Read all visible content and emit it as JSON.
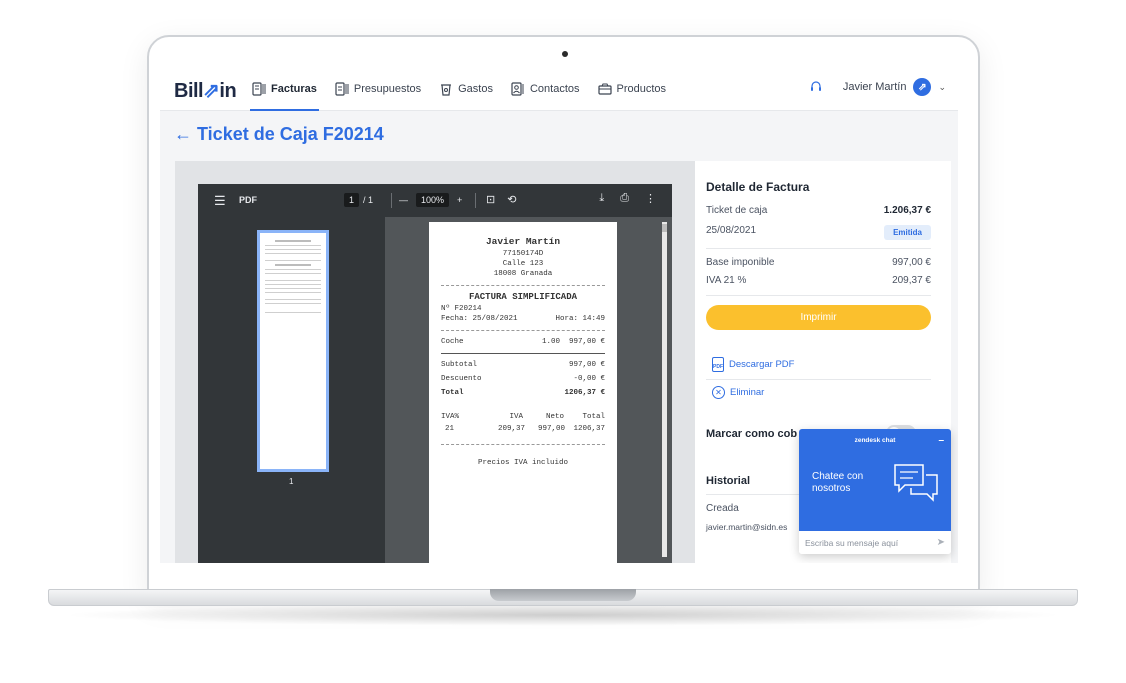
{
  "app": {
    "logo_text": "Bill",
    "logo_suffix": "in",
    "nav": [
      {
        "label": "Facturas",
        "icon": "invoice-icon",
        "active": true
      },
      {
        "label": "Presupuestos",
        "icon": "budget-icon",
        "active": false
      },
      {
        "label": "Gastos",
        "icon": "expense-icon",
        "active": false
      },
      {
        "label": "Contactos",
        "icon": "contacts-icon",
        "active": false
      },
      {
        "label": "Productos",
        "icon": "products-icon",
        "active": false
      }
    ],
    "user_name": "Javier Martín",
    "accent_color": "#2f6de1"
  },
  "page": {
    "title": "Ticket de Caja F20214"
  },
  "pdf_viewer": {
    "title": "PDF",
    "page_current": "1",
    "page_total": "/ 1",
    "zoom": "100%",
    "thumbnail_page": "1"
  },
  "receipt": {
    "name": "Javier Martín",
    "tax_id": "77150174D",
    "address": "Calle 123",
    "city": "18008 Granada",
    "doc_title": "FACTURA SIMPLIFICADA",
    "number": "Nº F20214",
    "date": "Fecha: 25/08/2021",
    "time": "Hora: 14:49",
    "item_name": "Coche",
    "item_qty": "1.00",
    "item_amount": "997,00 €",
    "subtotal_label": "Subtotal",
    "subtotal_value": "997,00 €",
    "discount_label": "Descuento",
    "discount_value": "-0,00 €",
    "total_label": "Total",
    "total_value": "1206,37 €",
    "tax_headers": [
      "IVA%",
      "IVA",
      "Neto",
      "Total"
    ],
    "tax_row": [
      "21",
      "209,37",
      "997,00",
      "1206,37"
    ],
    "footer": "Precios IVA incluido"
  },
  "detail": {
    "heading": "Detalle de Factura",
    "type_label": "Ticket de caja",
    "type_amount": "1.206,37 €",
    "date": "25/08/2021",
    "status": "Emitida",
    "base_label": "Base imponible",
    "base_value": "997,00 €",
    "iva_label": "IVA 21 %",
    "iva_value": "209,37 €",
    "print_label": "Imprimir",
    "download_label": "Descargar PDF",
    "delete_label": "Eliminar",
    "mark_paid_label": "Marcar como cob",
    "history_heading": "Historial",
    "history_event": "Creada",
    "history_user": "javier.martin@sidn.es"
  },
  "chat": {
    "brand": "zendesk chat",
    "minimize": "–",
    "prompt": "Chatee con nosotros",
    "input_placeholder": "Escriba su mensaje aquí"
  }
}
